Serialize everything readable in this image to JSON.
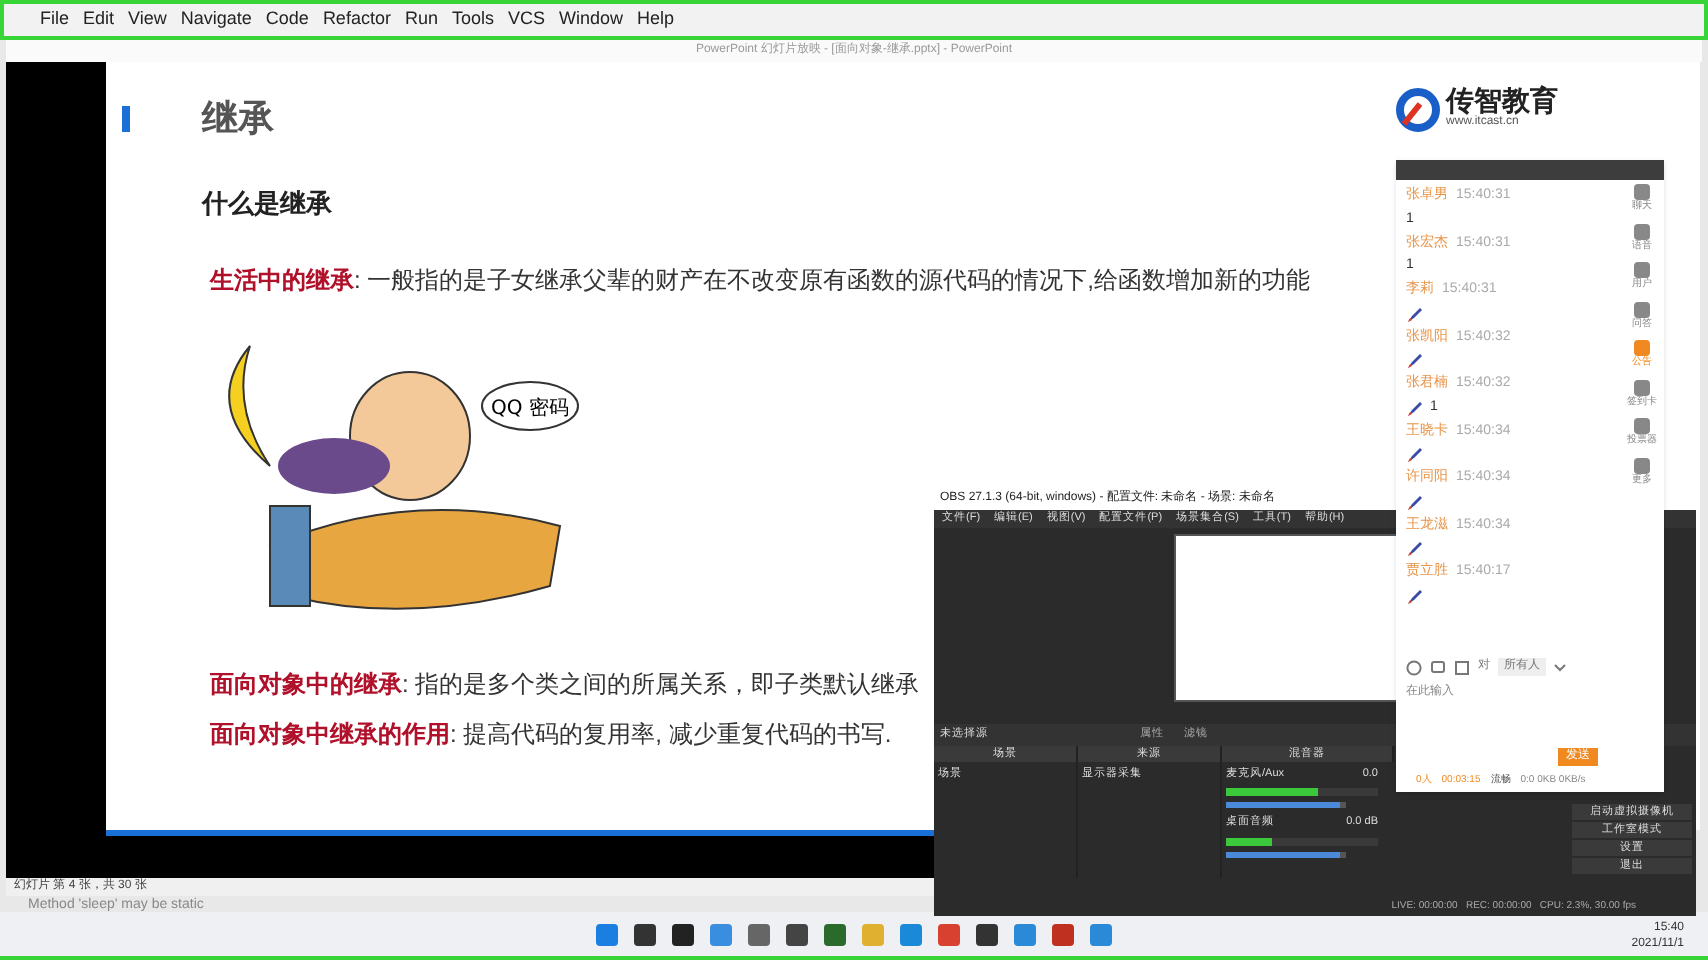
{
  "ide_menu": [
    "File",
    "Edit",
    "View",
    "Navigate",
    "Code",
    "Refactor",
    "Run",
    "Tools",
    "VCS",
    "Window",
    "Help"
  ],
  "ppt": {
    "title": "PowerPoint 幻灯片放映 - [面向对象-继承.pptx] - PowerPoint",
    "status": "幻灯片 第 4 张，共 30 张"
  },
  "ide_status": "Method 'sleep' may be static",
  "slide": {
    "title": "继承",
    "subtitle": "什么是继承",
    "logo_name": "传智教育",
    "logo_url": "www.itcast.cn",
    "bubble": "QQ 密码",
    "paragraphs": [
      {
        "term": "生活中的继承",
        "text": ": 一般指的是子女继承父辈的财产在不改变原有函数的源代码的情况下,给函数增加新的功能"
      },
      {
        "term": "面向对象中的继承",
        "text": ": 指的是多个类之间的所属关系，即子类默认继承"
      },
      {
        "term": "面向对象中继承的作用",
        "text": ": 提高代码的复用率, 减少重复代码的书写."
      }
    ]
  },
  "chat": {
    "messages": [
      {
        "name": "张卓男",
        "time": "15:40:31",
        "text": "1",
        "rocket": false
      },
      {
        "name": "张宏杰",
        "time": "15:40:31",
        "text": "1",
        "rocket": false
      },
      {
        "name": "李莉",
        "time": "15:40:31",
        "rocket": true
      },
      {
        "name": "张凯阳",
        "time": "15:40:32",
        "rocket": true
      },
      {
        "name": "张君楠",
        "time": "15:40:32",
        "text": "1",
        "rocket": true
      },
      {
        "name": "王晓卡",
        "time": "15:40:34",
        "rocket": true
      },
      {
        "name": "许同阳",
        "time": "15:40:34",
        "rocket": true
      },
      {
        "name": "王龙滋",
        "time": "15:40:34",
        "rocket": true
      },
      {
        "name": "贾立胜",
        "time": "15:40:17",
        "rocket": true
      }
    ],
    "side": [
      {
        "label": "聊天",
        "selected": false
      },
      {
        "label": "语音",
        "selected": false
      },
      {
        "label": "用户",
        "selected": false
      },
      {
        "label": "问答",
        "selected": false
      },
      {
        "label": "公告",
        "selected": true
      },
      {
        "label": "签到卡",
        "selected": false
      },
      {
        "label": "投票器",
        "selected": false
      },
      {
        "label": "更多",
        "selected": false
      }
    ],
    "to_label": "对",
    "recipient": "所有人",
    "placeholder": "在此输入",
    "send": "发送",
    "footer": [
      "0人",
      "00:03:15",
      "流畅",
      "0:0 0KB 0KB/s"
    ]
  },
  "obs": {
    "title": "OBS 27.1.3 (64-bit, windows) - 配置文件: 未命名 - 场景: 未命名",
    "menu": [
      "文件(F)",
      "编辑(E)",
      "视图(V)",
      "配置文件(P)",
      "场景集合(S)",
      "工具(T)",
      "帮助(H)"
    ],
    "no_source": "未选择源",
    "props": "属性",
    "filters": "滤镜",
    "docks": [
      "场景",
      "来源",
      "混音器"
    ],
    "scene": "场景",
    "source": "显示器采集",
    "mixer": [
      {
        "name": "麦克风/Aux",
        "db": "0.0",
        "meter": {
          "level": 0.6
        },
        "volume": {
          "level": 0.95
        }
      },
      {
        "name": "桌面音频",
        "db": "0.0 dB",
        "meter": {
          "level": 0.3
        },
        "volume": {
          "level": 0.95
        }
      }
    ],
    "controls": [
      "启动虚拟摄像机",
      "工作室模式",
      "设置",
      "退出"
    ],
    "status": "LIVE: 00:00:00   REC: 00:00:00   CPU: 2.3%, 30.00 fps"
  },
  "clock": {
    "time": "15:40",
    "date": "2021/11/1"
  }
}
